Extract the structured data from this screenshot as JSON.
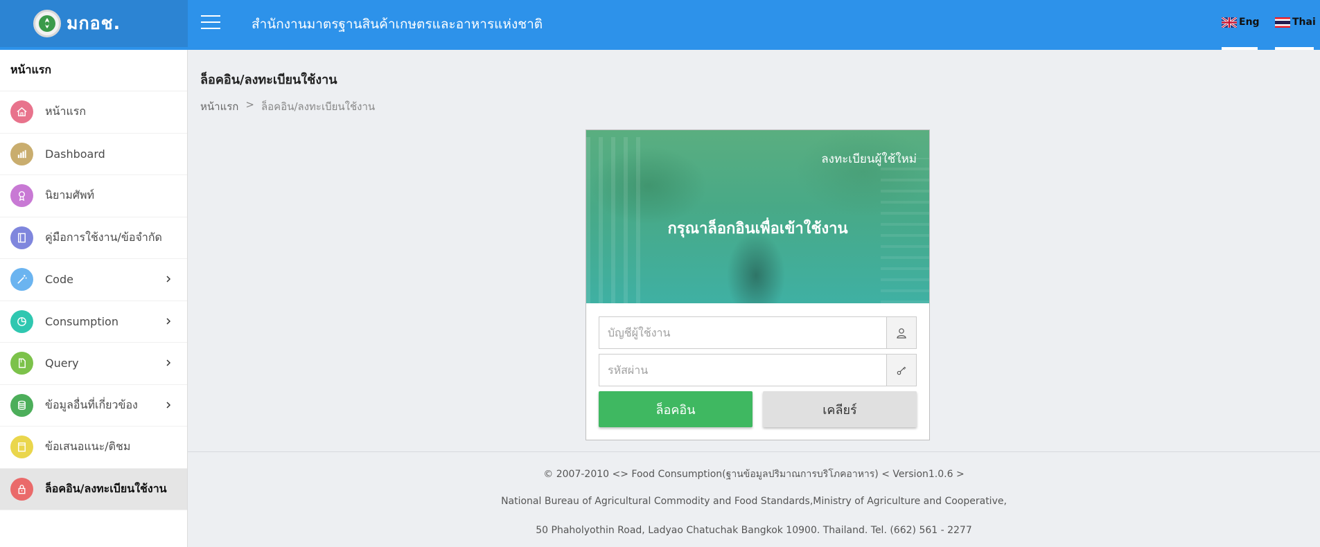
{
  "header": {
    "brand_name": "มกอช.",
    "org_title": "สำนักงานมาตรฐานสินค้าเกษตรและอาหารแห่งชาติ",
    "lang_eng": "Eng",
    "lang_thai": "Thai",
    "bar_color": "#2d92ea"
  },
  "sidebar": {
    "heading": "หน้าแรก",
    "items": [
      {
        "label": "หน้าแรก",
        "icon": "home-icon",
        "color": "#e8738c",
        "has_submenu": false
      },
      {
        "label": "Dashboard",
        "icon": "bar-chart-icon",
        "color": "#c9ad6e",
        "has_submenu": false
      },
      {
        "label": "นิยามศัพท์",
        "icon": "award-icon",
        "color": "#c879d4",
        "has_submenu": false
      },
      {
        "label": "คู่มือการใช้งาน/ข้อจำกัด",
        "icon": "book-icon",
        "color": "#7f86dd",
        "has_submenu": false
      },
      {
        "label": "Code",
        "icon": "magic-wand-icon",
        "color": "#6bb4f0",
        "has_submenu": true
      },
      {
        "label": "Consumption",
        "icon": "pie-chart-icon",
        "color": "#2fc7b0",
        "has_submenu": true
      },
      {
        "label": "Query",
        "icon": "document-icon",
        "color": "#7cc24a",
        "has_submenu": true
      },
      {
        "label": "ข้อมูลอื่นที่เกี่ยวข้อง",
        "icon": "database-icon",
        "color": "#4cae5a",
        "has_submenu": true
      },
      {
        "label": "ข้อเสนอแนะ/ติชม",
        "icon": "notepad-icon",
        "color": "#ead64c",
        "has_submenu": false
      },
      {
        "label": "ล็อคอิน/ลงทะเบียนใช้งาน",
        "icon": "lock-icon",
        "color": "#ea6a6a",
        "has_submenu": false,
        "active": true
      }
    ]
  },
  "main": {
    "page_title": "ล็อคอิน/ลงทะเบียนใช้งาน",
    "breadcrumb": {
      "home": "หน้าแรก",
      "separator": ">",
      "current": "ล็อคอิน/ลงทะเบียนใช้งาน"
    }
  },
  "login": {
    "register_link": "ลงทะเบียนผู้ใช้ใหม่",
    "hero_title": "กรุณาล็อกอินเพื่อเข้าใช้งาน",
    "username_placeholder": "บัญชีผู้ใช้งาน",
    "username_value": "",
    "password_placeholder": "รหัสผ่าน",
    "password_value": "",
    "login_button": "ล็อคอิน",
    "clear_button": "เคลียร์"
  },
  "footer": {
    "line1": "© 2007-2010 <> Food Consumption(ฐานข้อมูลปริมาณการบริโภคอาหาร) < Version1.0.6 >",
    "line2": "National Bureau of Agricultural Commodity and Food Standards,Ministry of Agriculture and Cooperative,",
    "line3": "50 Phaholyothin Road, Ladyao Chatuchak Bangkok 10900. Thailand. Tel. (662) 561 - 2277"
  }
}
